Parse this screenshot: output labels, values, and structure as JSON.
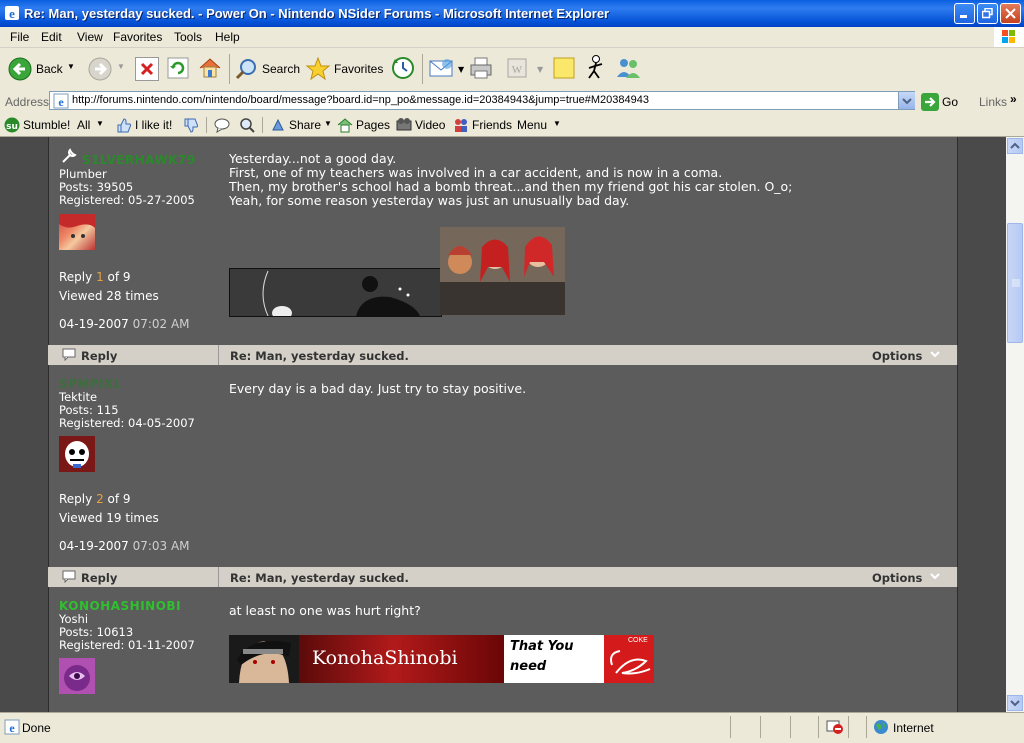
{
  "window": {
    "title": "Re: Man, yesterday sucked. - Power On - Nintendo NSider Forums - Microsoft Internet Explorer"
  },
  "menu": [
    "File",
    "Edit",
    "View",
    "Favorites",
    "Tools",
    "Help"
  ],
  "toolbar": {
    "back_label": "Back",
    "search_label": "Search",
    "favorites_label": "Favorites"
  },
  "address": {
    "label": "Address",
    "url": "http://forums.nintendo.com/nintendo/board/message?board.id=np_po&message.id=20384943&jump=true#M20384943",
    "go_label": "Go",
    "links_label": "Links"
  },
  "stumblebar": {
    "stumble_label": "Stumble!",
    "all_label": "All",
    "like_label": "I like it!",
    "share_label": "Share",
    "pages_label": "Pages",
    "video_label": "Video",
    "friends_label": "Friends",
    "menu_label": "Menu"
  },
  "posts": [
    {
      "username": "S1LVERHAWK79",
      "username_color": "#2a8a2a",
      "rank": "Plumber",
      "posts": "Posts: 39505",
      "registered": "Registered: 05-27-2005",
      "reply_word": "Reply",
      "reply_num": "1",
      "reply_of": "of 9",
      "viewed": "Viewed 28 times",
      "date": "04-19-2007",
      "time": "07:02 AM",
      "body": "Yesterday...not a good day.\nFirst, one of my teachers was involved in a car accident, and is now in a coma.\nThen, my brother's school had a bomb threat...and then my friend got his car stolen. O_o;\nYeah, for some reason yesterday was just an unusually bad day."
    },
    {
      "reply_button": "Reply",
      "subject": "Re: Man, yesterday sucked.",
      "options_label": "Options",
      "username": "SPMPIXL",
      "username_color": "#3d6e3d",
      "rank": "Tektite",
      "posts": "Posts: 115",
      "registered": "Registered: 04-05-2007",
      "reply_word": "Reply",
      "reply_num": "2",
      "reply_of": "of 9",
      "viewed": "Viewed 19 times",
      "date": "04-19-2007",
      "time": "07:03 AM",
      "body": "Every day is a bad day. Just try to stay positive."
    },
    {
      "reply_button": "Reply",
      "subject": "Re: Man, yesterday sucked.",
      "options_label": "Options",
      "username": "KONOHASHINOBI",
      "username_color": "#2fbf2f",
      "rank": "Yoshi",
      "posts": "Posts: 10613",
      "registered": "Registered: 01-11-2007",
      "body": "at least no one was hurt right?",
      "sig_name": "KonohaShinobi",
      "sig_tagline": "That You need",
      "sig_brand": "COKE"
    }
  ],
  "status": {
    "text": "Done",
    "zone": "Internet"
  },
  "colors": {
    "page_bg": "#4a4a4a",
    "post_bg": "#5c5c5c",
    "reply_bar": "#d4d0c8",
    "titlebar": "#0553d7"
  }
}
